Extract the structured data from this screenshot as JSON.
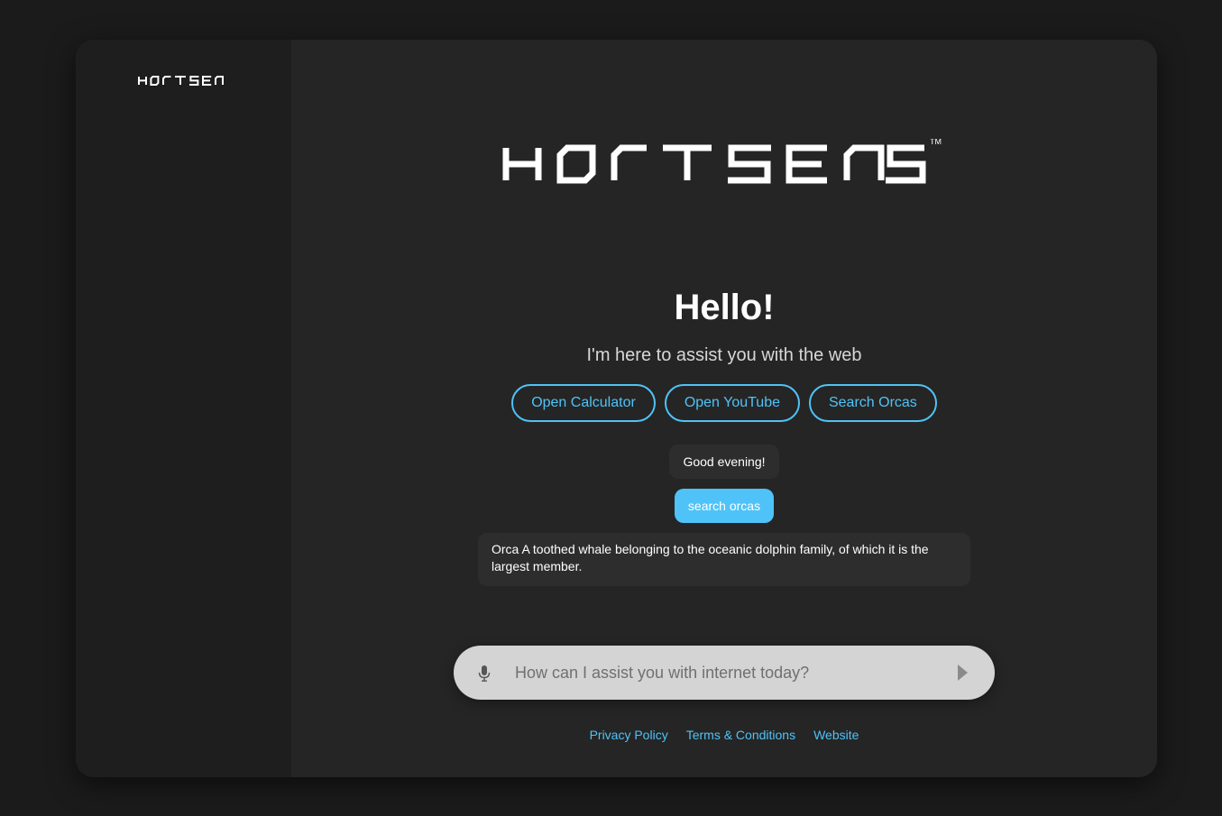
{
  "app": {
    "brand": "HORTSENS",
    "trademark": "TM"
  },
  "colors": {
    "accent": "#4fc3f7",
    "background": "#1b1b1b",
    "panel": "#252525",
    "sidebar": "#1e1e1e",
    "input_bg": "#d4d4d4"
  },
  "hero": {
    "greeting": "Hello!",
    "subtitle": "I'm here to assist you with the web"
  },
  "suggestions": [
    {
      "label": "Open Calculator"
    },
    {
      "label": "Open YouTube"
    },
    {
      "label": "Search Orcas"
    }
  ],
  "chat": {
    "messages": [
      {
        "role": "bot",
        "text": "Good evening!"
      },
      {
        "role": "user",
        "text": "search orcas"
      },
      {
        "role": "bot",
        "text": "Orca A toothed whale belonging to the oceanic dolphin family, of which it is the largest member."
      }
    ]
  },
  "input": {
    "value": "",
    "placeholder": "How can I assist you with internet today?",
    "mic_icon": "microphone-icon",
    "send_icon": "send-icon"
  },
  "footer": {
    "links": [
      {
        "label": "Privacy Policy"
      },
      {
        "label": "Terms & Conditions"
      },
      {
        "label": "Website"
      }
    ]
  }
}
